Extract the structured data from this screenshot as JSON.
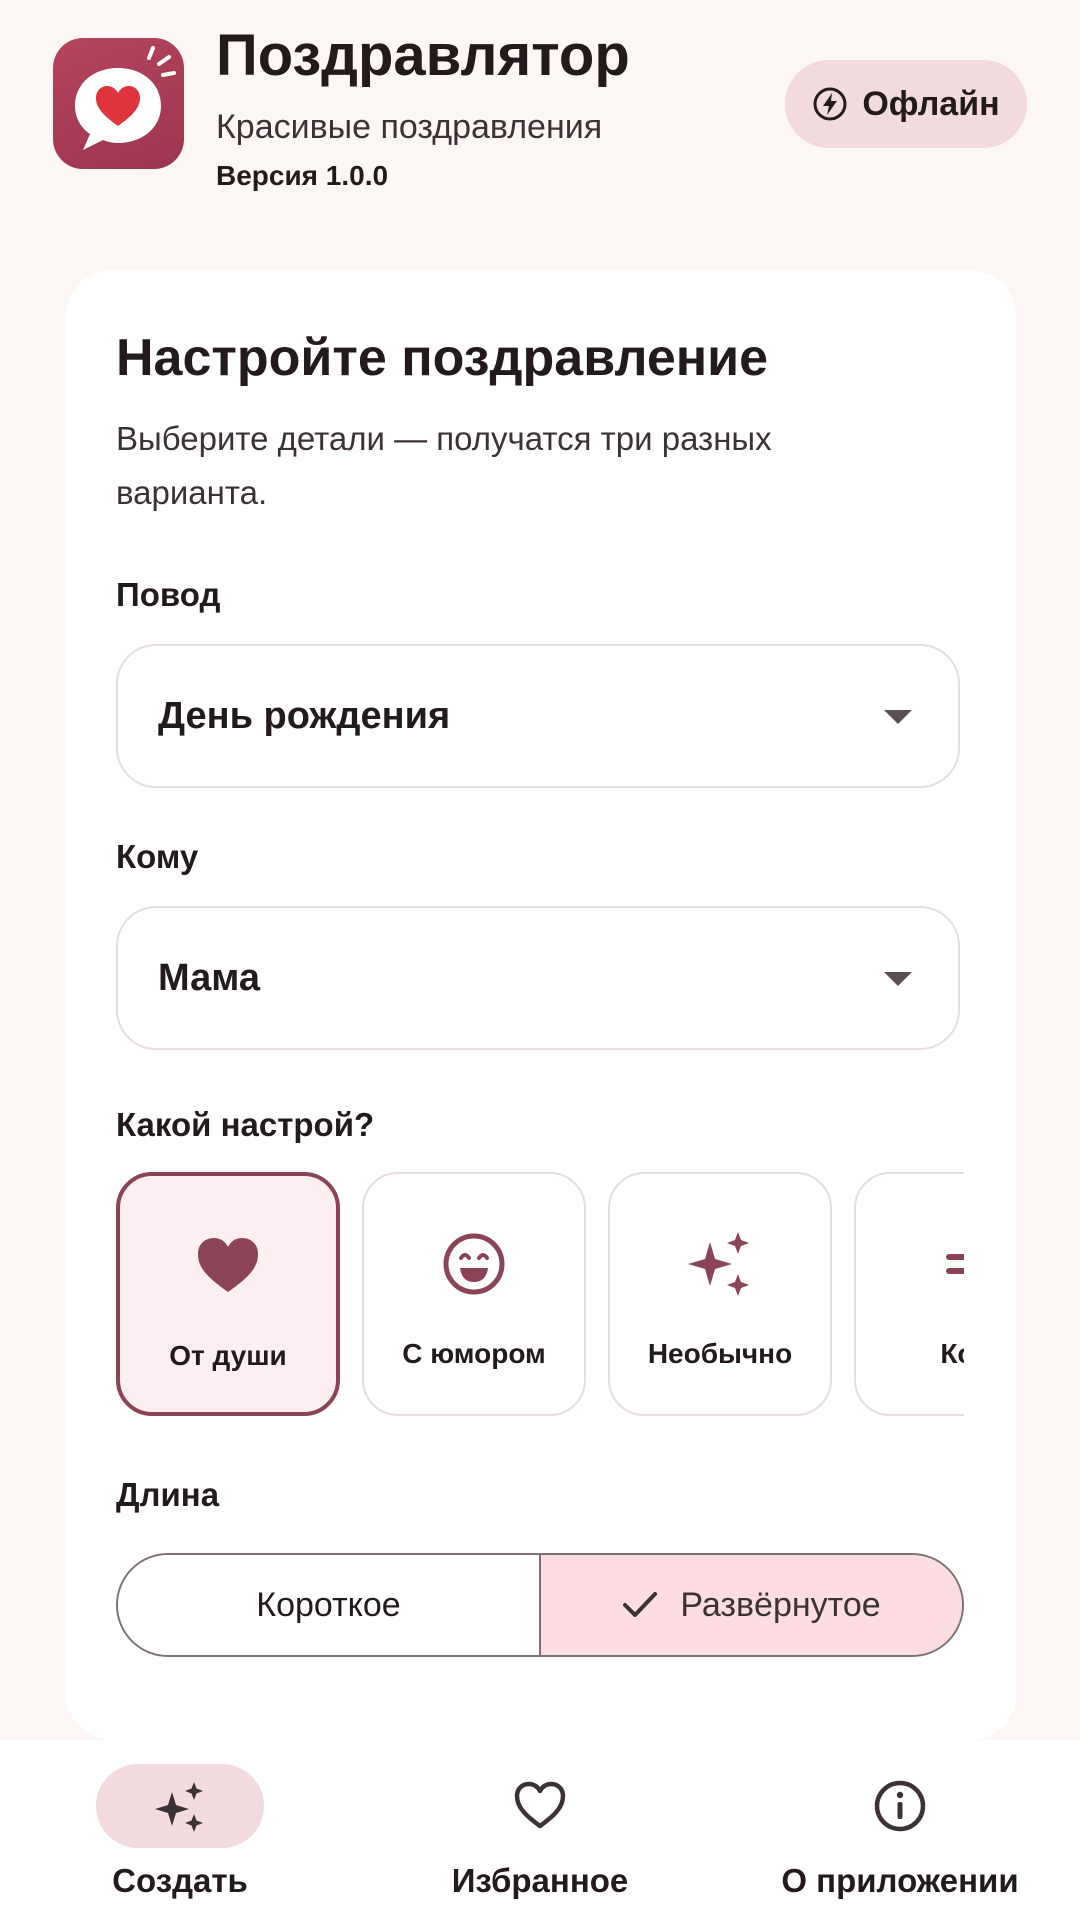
{
  "header": {
    "title": "Поздравлятор",
    "subtitle": "Красивые поздравления",
    "version": "Версия 1.0.0",
    "offline_label": "Офлайн",
    "app_icon": "heart-speech-bubble-icon",
    "offline_icon": "bolt-circle-icon"
  },
  "card": {
    "title": "Настройте поздравление",
    "description": "Выберите детали — получатся три разных варианта."
  },
  "form": {
    "occasion": {
      "label": "Повод",
      "value": "День рождения"
    },
    "recipient": {
      "label": "Кому",
      "value": "Мама"
    },
    "mood": {
      "label": "Какой настрой?",
      "options": [
        {
          "label": "От души",
          "icon": "heart-icon",
          "selected": true
        },
        {
          "label": "С юмором",
          "icon": "smile-icon",
          "selected": false
        },
        {
          "label": "Необычно",
          "icon": "sparkles-icon",
          "selected": false
        },
        {
          "label": "Кор",
          "icon": "short-text-icon",
          "selected": false
        }
      ]
    },
    "length": {
      "label": "Длина",
      "options": [
        {
          "label": "Короткое",
          "selected": false
        },
        {
          "label": "Развёрнутое",
          "selected": true
        }
      ]
    }
  },
  "nav": {
    "items": [
      {
        "label": "Создать",
        "icon": "sparkles-icon",
        "active": true
      },
      {
        "label": "Избранное",
        "icon": "heart-outline-icon",
        "active": false
      },
      {
        "label": "О приложении",
        "icon": "info-icon",
        "active": false
      }
    ]
  },
  "colors": {
    "background": "#fdf7f5",
    "accent": "#8a4456",
    "accent_container": "#f3dade",
    "selected_segment": "#fcdde2",
    "icon_gradient_start": "#b4455c",
    "heart": "#e0343f"
  }
}
